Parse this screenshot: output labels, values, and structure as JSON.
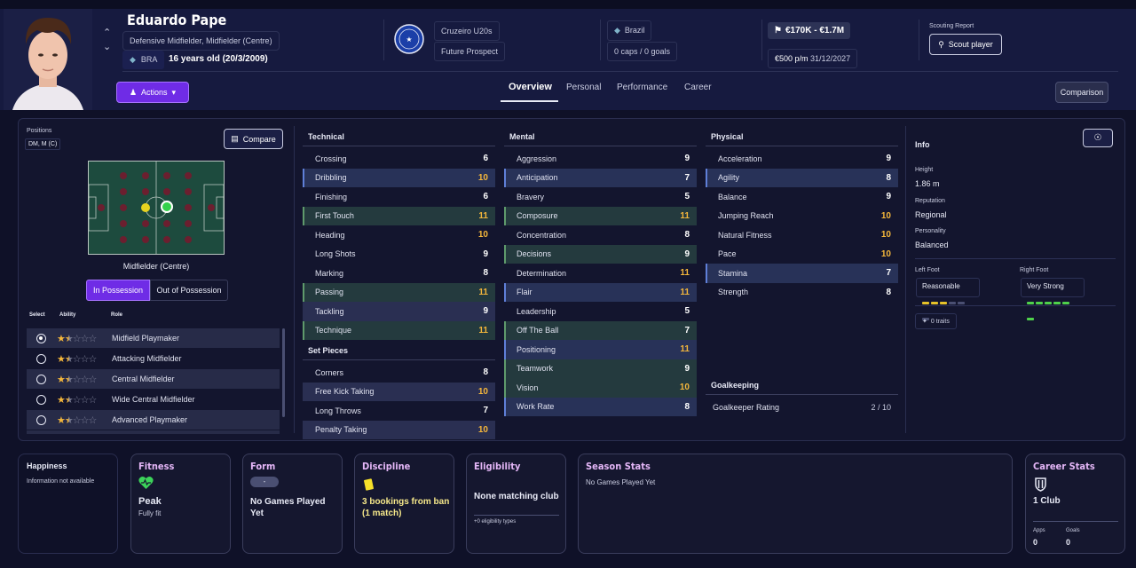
{
  "header": {
    "player_name": "Eduardo Pape",
    "positions_text": "Defensive Midfielder, Midfielder (Centre)",
    "nationality_code": "BRA",
    "age_text": "16 years old (20/3/2009)",
    "actions_label": "Actions",
    "club_name": "Cruzeiro U20s",
    "club_status": "Future Prospect",
    "nation": "Brazil",
    "caps_goals": "0 caps / 0 goals",
    "value_range": "€170K - €1.7M",
    "wage": "€500 p/m",
    "contract_end": "31/12/2027",
    "scouting_report_label": "Scouting Report",
    "scout_button": "Scout player",
    "comparison_button": "Comparison",
    "tabs": [
      {
        "label": "Overview",
        "active": true
      },
      {
        "label": "Personal",
        "active": false
      },
      {
        "label": "Performance",
        "active": false
      },
      {
        "label": "Career",
        "active": false
      }
    ]
  },
  "positions": {
    "label": "Positions",
    "value": "DM, M (C)",
    "compare_button": "Compare",
    "pitch_caption": "Midfielder (Centre)",
    "toggle": {
      "in_possession": "In Possession",
      "out_of_possession": "Out of Possession"
    }
  },
  "roles": {
    "headers": {
      "select": "Select",
      "ability": "Ability",
      "role": "Role"
    },
    "items": [
      {
        "name": "Midfield Playmaker",
        "stars": 1.5,
        "selected": true
      },
      {
        "name": "Attacking Midfielder",
        "stars": 1.5,
        "selected": false
      },
      {
        "name": "Central Midfielder",
        "stars": 1.5,
        "selected": false
      },
      {
        "name": "Wide Central Midfielder",
        "stars": 1.5,
        "selected": false
      },
      {
        "name": "Advanced Playmaker",
        "stars": 1.5,
        "selected": false
      }
    ]
  },
  "technical": {
    "title": "Technical",
    "rows": [
      {
        "name": "Crossing",
        "value": "6",
        "style": "plain"
      },
      {
        "name": "Dribbling",
        "value": "10",
        "style": "blue"
      },
      {
        "name": "Finishing",
        "value": "6",
        "style": "plain"
      },
      {
        "name": "First Touch",
        "value": "11",
        "style": "green"
      },
      {
        "name": "Heading",
        "value": "10",
        "style": "plain"
      },
      {
        "name": "Long Shots",
        "value": "9",
        "style": "plain"
      },
      {
        "name": "Marking",
        "value": "8",
        "style": "plain"
      },
      {
        "name": "Passing",
        "value": "11",
        "style": "green"
      },
      {
        "name": "Tackling",
        "value": "9",
        "style": "shaded"
      },
      {
        "name": "Technique",
        "value": "11",
        "style": "green"
      }
    ]
  },
  "set_pieces": {
    "title": "Set Pieces",
    "rows": [
      {
        "name": "Corners",
        "value": "8",
        "style": "plain"
      },
      {
        "name": "Free Kick Taking",
        "value": "10",
        "style": "shaded"
      },
      {
        "name": "Long Throws",
        "value": "7",
        "style": "plain"
      },
      {
        "name": "Penalty Taking",
        "value": "10",
        "style": "shaded"
      }
    ]
  },
  "mental": {
    "title": "Mental",
    "rows": [
      {
        "name": "Aggression",
        "value": "9",
        "style": "plain"
      },
      {
        "name": "Anticipation",
        "value": "7",
        "style": "blue"
      },
      {
        "name": "Bravery",
        "value": "5",
        "style": "plain"
      },
      {
        "name": "Composure",
        "value": "11",
        "style": "green"
      },
      {
        "name": "Concentration",
        "value": "8",
        "style": "plain"
      },
      {
        "name": "Decisions",
        "value": "9",
        "style": "green"
      },
      {
        "name": "Determination",
        "value": "11",
        "style": "plain"
      },
      {
        "name": "Flair",
        "value": "11",
        "style": "blue"
      },
      {
        "name": "Leadership",
        "value": "5",
        "style": "plain"
      },
      {
        "name": "Off The Ball",
        "value": "7",
        "style": "green"
      },
      {
        "name": "Positioning",
        "value": "11",
        "style": "blue"
      },
      {
        "name": "Teamwork",
        "value": "9",
        "style": "green"
      },
      {
        "name": "Vision",
        "value": "10",
        "style": "green"
      },
      {
        "name": "Work Rate",
        "value": "8",
        "style": "blue"
      }
    ]
  },
  "physical": {
    "title": "Physical",
    "rows": [
      {
        "name": "Acceleration",
        "value": "9",
        "style": "plain"
      },
      {
        "name": "Agility",
        "value": "8",
        "style": "blue"
      },
      {
        "name": "Balance",
        "value": "9",
        "style": "plain"
      },
      {
        "name": "Jumping Reach",
        "value": "10",
        "style": "plain"
      },
      {
        "name": "Natural Fitness",
        "value": "10",
        "style": "plain"
      },
      {
        "name": "Pace",
        "value": "10",
        "style": "plain"
      },
      {
        "name": "Stamina",
        "value": "7",
        "style": "blue"
      },
      {
        "name": "Strength",
        "value": "8",
        "style": "plain"
      }
    ]
  },
  "goalkeeping": {
    "title": "Goalkeeping",
    "label": "Goalkeeper Rating",
    "value": "2 / 10"
  },
  "info": {
    "title": "Info",
    "height_label": "Height",
    "height": "1.86 m",
    "reputation_label": "Reputation",
    "reputation": "Regional",
    "personality_label": "Personality",
    "personality": "Balanced",
    "left_foot_label": "Left Foot",
    "left_foot": "Reasonable",
    "right_foot_label": "Right Foot",
    "right_foot": "Very Strong",
    "traits": "0 traits"
  },
  "cards": {
    "happiness": {
      "title": "Happiness",
      "text": "Information not available"
    },
    "fitness": {
      "title": "Fitness",
      "status": "Peak",
      "detail": "Fully fit"
    },
    "form": {
      "title": "Form",
      "badge": "-",
      "text": "No Games Played Yet"
    },
    "discipline": {
      "title": "Discipline",
      "text": "3 bookings from ban (1 match)"
    },
    "eligibility": {
      "title": "Eligibility",
      "text": "None matching club",
      "detail": "+0 eligibility types"
    },
    "season_stats": {
      "title": "Season Stats",
      "text": "No Games Played Yet"
    },
    "career_stats": {
      "title": "Career Stats",
      "clubs": "1 Club",
      "apps_label": "Apps",
      "apps": "0",
      "goals_label": "Goals",
      "goals": "0"
    }
  },
  "colors": {
    "accent": "#7b2ff7",
    "highlight_value": "#f5b73b",
    "good_foot": "#4fd14b",
    "reasonable_foot": "#e6c229"
  }
}
